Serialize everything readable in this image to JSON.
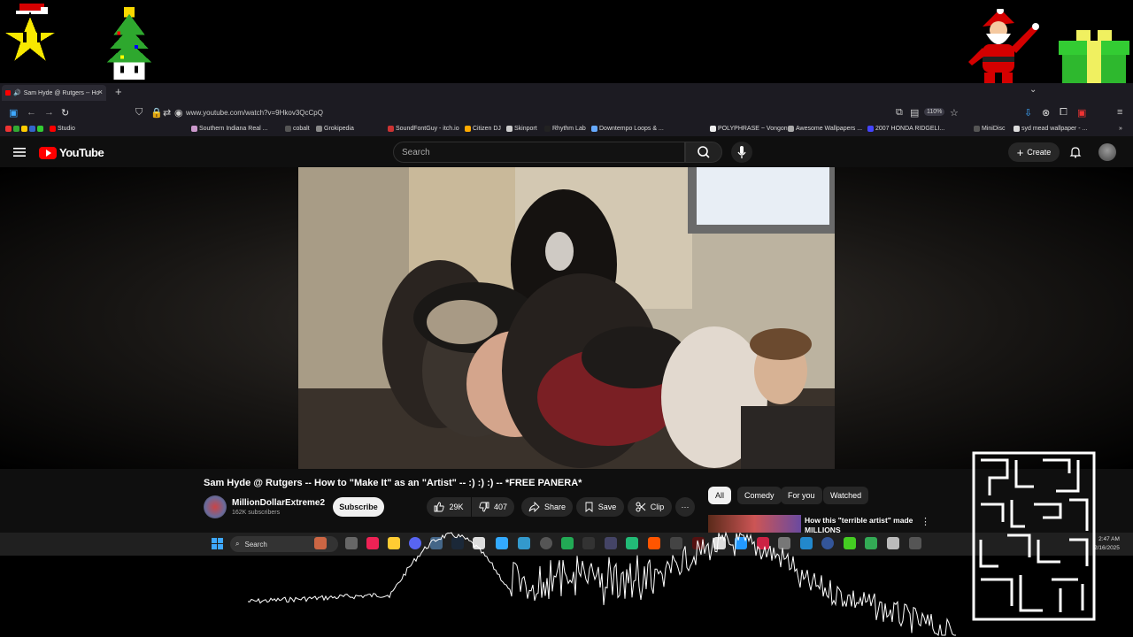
{
  "browser": {
    "tab_title": "Sam Hyde @ Rutgers -- Ho",
    "tab_close": "×",
    "new_tab": "+",
    "tab_list": "⌄",
    "url": "www.youtube.com/watch?v=9Hkov3QcCpQ",
    "zoom": "110%",
    "bookmarks": [
      "Studio",
      "Southern Indiana Real ...",
      "cobalt",
      "Grokipedia",
      "SoundFontGuy - itch.io",
      "Citizen DJ",
      "Skinport",
      "Rhythm Lab",
      "Downtempo Loops & ...",
      "POLYPHRASE ~ Vongon",
      "Awesome Wallpapers ...",
      "2007 HONDA RIDGELI...",
      "MiniDisc",
      "syd mead wallpaper - ..."
    ],
    "bookmark_chevron": "»"
  },
  "youtube": {
    "logo_text": "YouTube",
    "search_placeholder": "Search",
    "create_label": "Create",
    "create_plus": "+",
    "video": {
      "title": "Sam Hyde @ Rutgers -- How to \"Make It\" as an \"Artist\" -- :) :) :) -- *FREE PANERA*",
      "channel": "MillionDollarExtreme2",
      "subscribers": "162K subscribers",
      "subscribe_label": "Subscribe",
      "likes": "29K",
      "dislikes": "407",
      "share_label": "Share",
      "save_label": "Save",
      "clip_label": "Clip",
      "more_label": "···"
    },
    "chips": [
      "All",
      "Comedy",
      "For you",
      "Watched"
    ],
    "recommendation": {
      "title": "How this \"terrible artist\" made MILLIONS",
      "menu": "⋮"
    }
  },
  "taskbar": {
    "search_label": "Search",
    "time": "2:47 AM",
    "date": "2/16/2025"
  },
  "colors": {
    "youtube_red": "#ff0000",
    "page_bg": "#0f0f0f",
    "chip_bg": "#272727",
    "accent_blue": "#3ea8ff"
  },
  "icons": [
    "menu-icon",
    "search-icon",
    "mic-icon",
    "bell-icon",
    "like-icon",
    "dislike-icon",
    "share-icon",
    "save-icon",
    "clip-icon",
    "windows-start-icon"
  ]
}
